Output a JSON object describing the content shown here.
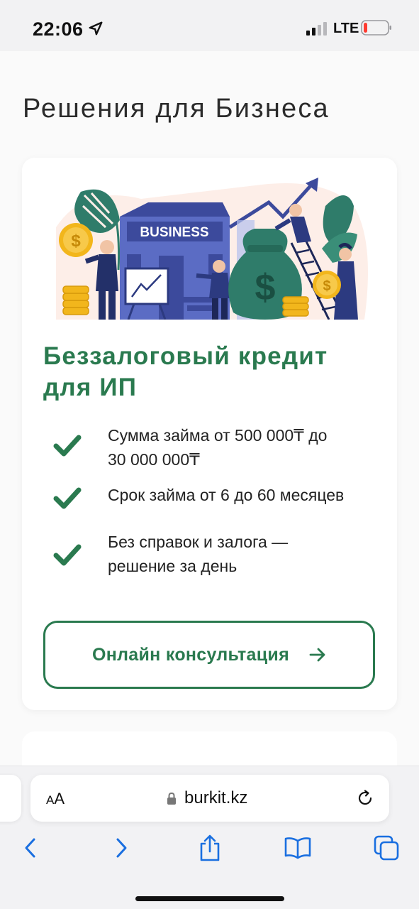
{
  "status_bar": {
    "time": "22:06",
    "network": "LTE",
    "icons": [
      "location-arrow-icon",
      "signal-bars-icon",
      "battery-low-icon"
    ]
  },
  "page": {
    "title": "Решения для Бизнеса"
  },
  "card": {
    "illustration_sign": "BUSINESS",
    "title": "Беззалоговый кредит для ИП",
    "features": [
      {
        "line1": "Сумма займа от 500 000₸ до",
        "line2": "30 000 000₸"
      },
      {
        "line1": "Срок займа от 6 до 60 месяцев",
        "line2": ""
      },
      {
        "line1": "Без справок и залога —",
        "line2": "решение за день"
      }
    ],
    "cta_label": "Онлайн консультация"
  },
  "browser": {
    "aa_small": "A",
    "aa_large": "A",
    "url": "burkit.kz",
    "toolbar_icons": [
      "back-icon",
      "forward-icon",
      "share-icon",
      "bookmarks-icon",
      "tabs-icon"
    ]
  },
  "colors": {
    "accent_green": "#2a7a4f",
    "page_bg": "#fafafa",
    "illustration_blue": "#4a5ab0",
    "coin_gold": "#f2b61c",
    "leaf_teal": "#2f7c6a"
  }
}
